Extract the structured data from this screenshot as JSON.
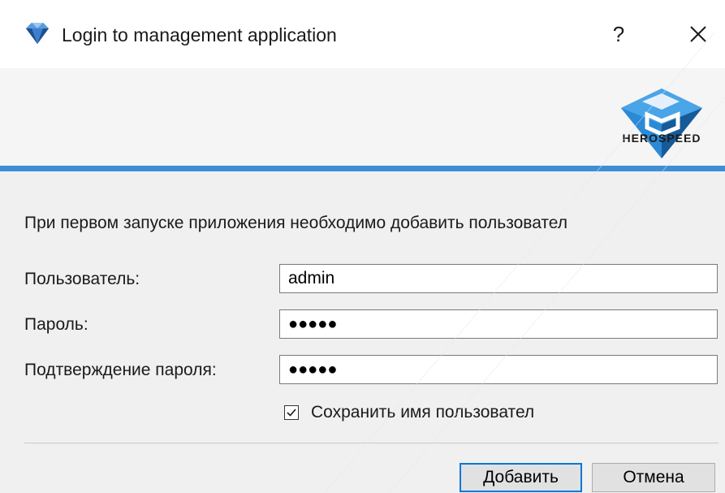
{
  "window": {
    "title": "Login to management application",
    "help_label": "?",
    "app_icon": "diamond-gem-icon",
    "close_icon": "close-icon"
  },
  "banner": {
    "logo_text": "HEROSPEED",
    "logo_icon": "herospeed-logo-icon",
    "accent_color": "#3e8ed6"
  },
  "form": {
    "intro": "При первом запуске приложения необходимо добавить пользовател",
    "username_label": "Пользователь:",
    "username_value": "admin",
    "password_label": "Пароль:",
    "password_value": "●●●●●",
    "confirm_label": "Подтверждение пароля:",
    "confirm_value": "●●●●●",
    "remember_label": "Сохранить имя пользовател",
    "remember_checked": true
  },
  "buttons": {
    "add_label": "Добавить",
    "cancel_label": "Отмена",
    "focus_color": "#0078d7"
  }
}
